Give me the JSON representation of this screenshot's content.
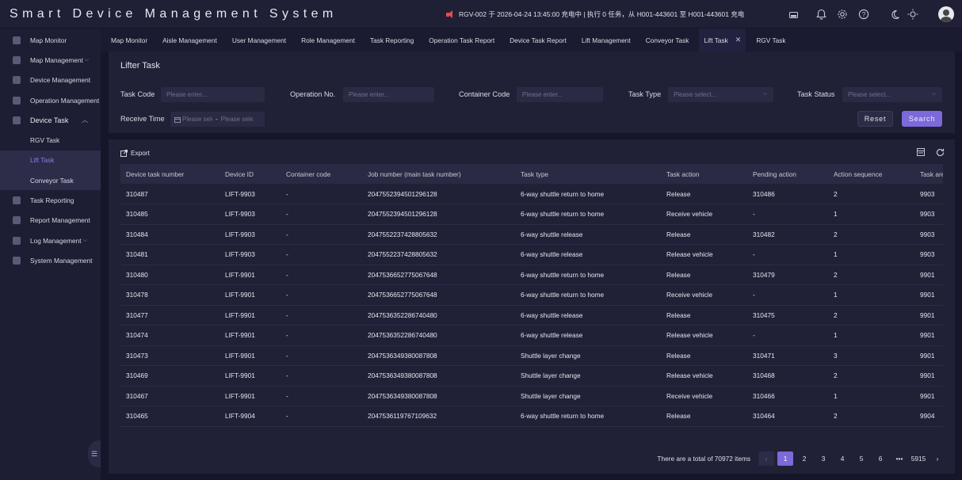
{
  "app": {
    "title": "Smart Device Management System"
  },
  "notice": {
    "text": "RGV-002 于 2026-04-24 13:45:00 充电中 | 执行 0 任务，从 H001-443601 至 H001-443601 充电"
  },
  "sidebar": {
    "items": [
      {
        "label": "Map Monitor"
      },
      {
        "label": "Map Management"
      },
      {
        "label": "Device Management"
      },
      {
        "label": "Operation Management"
      },
      {
        "label": "Device Task"
      },
      {
        "label": "RGV Task"
      },
      {
        "label": "Lift Task"
      },
      {
        "label": "Conveyor Task"
      },
      {
        "label": "Task Reporting"
      },
      {
        "label": "Report Management"
      },
      {
        "label": "Log Management"
      },
      {
        "label": "System Management"
      }
    ]
  },
  "tabs": [
    "Map Monitor",
    "Aisle Management",
    "User Management",
    "Role Management",
    "Task Reporting",
    "Operation Task Report",
    "Device Task Report",
    "Lift Management",
    "Conveyor Task",
    "Lift Task",
    "RGV Task"
  ],
  "page": {
    "title": "Lifter Task"
  },
  "filters": {
    "task_code": {
      "label": "Task Code",
      "placeholder": "Please enter..."
    },
    "operation_no": {
      "label": "Operation No.",
      "placeholder": "Please enter..."
    },
    "container_code": {
      "label": "Container Code",
      "placeholder": "Please enter..."
    },
    "task_type": {
      "label": "Task Type",
      "placeholder": "Please select..."
    },
    "task_status": {
      "label": "Task Status",
      "placeholder": "Please select..."
    },
    "receive_time": {
      "label": "Receive Time",
      "start_placeholder": "Please select",
      "sep": "-",
      "end_placeholder": "Please select"
    },
    "reset_label": "Reset",
    "search_label": "Search"
  },
  "toolbar": {
    "export_label": "Export"
  },
  "table": {
    "columns": [
      "Device task number",
      "Device ID",
      "Container code",
      "Job number (main task number)",
      "Task type",
      "Task action",
      "Pending action",
      "Action sequence",
      "Task area"
    ],
    "rows": [
      [
        "310487",
        "LIFT-9903",
        "-",
        "2047552394501296128",
        "6-way shuttle return to home",
        "Release",
        "310486",
        "2",
        "9903"
      ],
      [
        "310485",
        "LIFT-9903",
        "-",
        "2047552394501296128",
        "6-way shuttle return to home",
        "Receive vehicle",
        "-",
        "1",
        "9903"
      ],
      [
        "310484",
        "LIFT-9903",
        "-",
        "2047552237428805632",
        "6-way shuttle release",
        "Release",
        "310482",
        "2",
        "9903"
      ],
      [
        "310481",
        "LIFT-9903",
        "-",
        "2047552237428805632",
        "6-way shuttle release",
        "Release vehicle",
        "-",
        "1",
        "9903"
      ],
      [
        "310480",
        "LIFT-9901",
        "-",
        "2047536652775067648",
        "6-way shuttle return to home",
        "Release",
        "310479",
        "2",
        "9901"
      ],
      [
        "310478",
        "LIFT-9901",
        "-",
        "2047536652775067648",
        "6-way shuttle return to home",
        "Receive vehicle",
        "-",
        "1",
        "9901"
      ],
      [
        "310477",
        "LIFT-9901",
        "-",
        "2047536352286740480",
        "6-way shuttle release",
        "Release",
        "310475",
        "2",
        "9901"
      ],
      [
        "310474",
        "LIFT-9901",
        "-",
        "2047536352286740480",
        "6-way shuttle release",
        "Release vehicle",
        "-",
        "1",
        "9901"
      ],
      [
        "310473",
        "LIFT-9901",
        "-",
        "2047536349380087808",
        "Shuttle layer change",
        "Release",
        "310471",
        "3",
        "9901"
      ],
      [
        "310469",
        "LIFT-9901",
        "-",
        "2047536349380087808",
        "Shuttle layer change",
        "Release vehicle",
        "310468",
        "2",
        "9901"
      ],
      [
        "310467",
        "LIFT-9901",
        "-",
        "2047536349380087808",
        "Shuttle layer change",
        "Receive vehicle",
        "310466",
        "1",
        "9901"
      ],
      [
        "310465",
        "LIFT-9904",
        "-",
        "2047536119767109632",
        "6-way shuttle return to home",
        "Release",
        "310464",
        "2",
        "9904"
      ]
    ]
  },
  "pagination": {
    "total_text": "There are a total of 70972 items",
    "pages": [
      "1",
      "2",
      "3",
      "4",
      "5",
      "6"
    ],
    "ellipsis": "•••",
    "last": "5915",
    "current": "1"
  },
  "colors": {
    "accent": "#7b6ad8",
    "bg": "#16162a",
    "panel": "#202037",
    "alert": "#e34b4b"
  }
}
